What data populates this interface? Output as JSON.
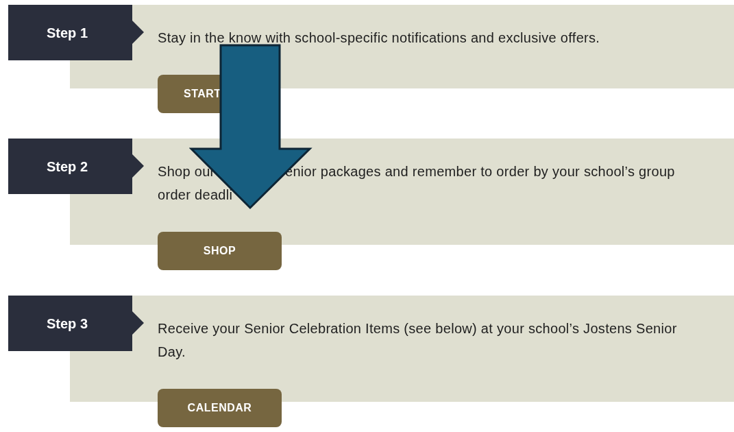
{
  "steps": [
    {
      "label": "Step 1",
      "lines": [
        [
          "Stay in the know with school-specific notifications and exclusive offers."
        ]
      ],
      "button": {
        "label": "START",
        "cut": true
      }
    },
    {
      "label": "Step 2",
      "lines": [
        [
          "Shop our",
          "enior packages and remember to order by your school’s group"
        ],
        [
          "order deadli"
        ]
      ],
      "button": {
        "label": "SHOP",
        "cut": false
      }
    },
    {
      "label": "Step 3",
      "lines": [
        [
          "Receive your Senior Celebration Items (see below) at your school’s Jostens Senior"
        ],
        [
          "Day."
        ]
      ],
      "button": {
        "label": "CALENDAR",
        "cut": false
      }
    }
  ]
}
